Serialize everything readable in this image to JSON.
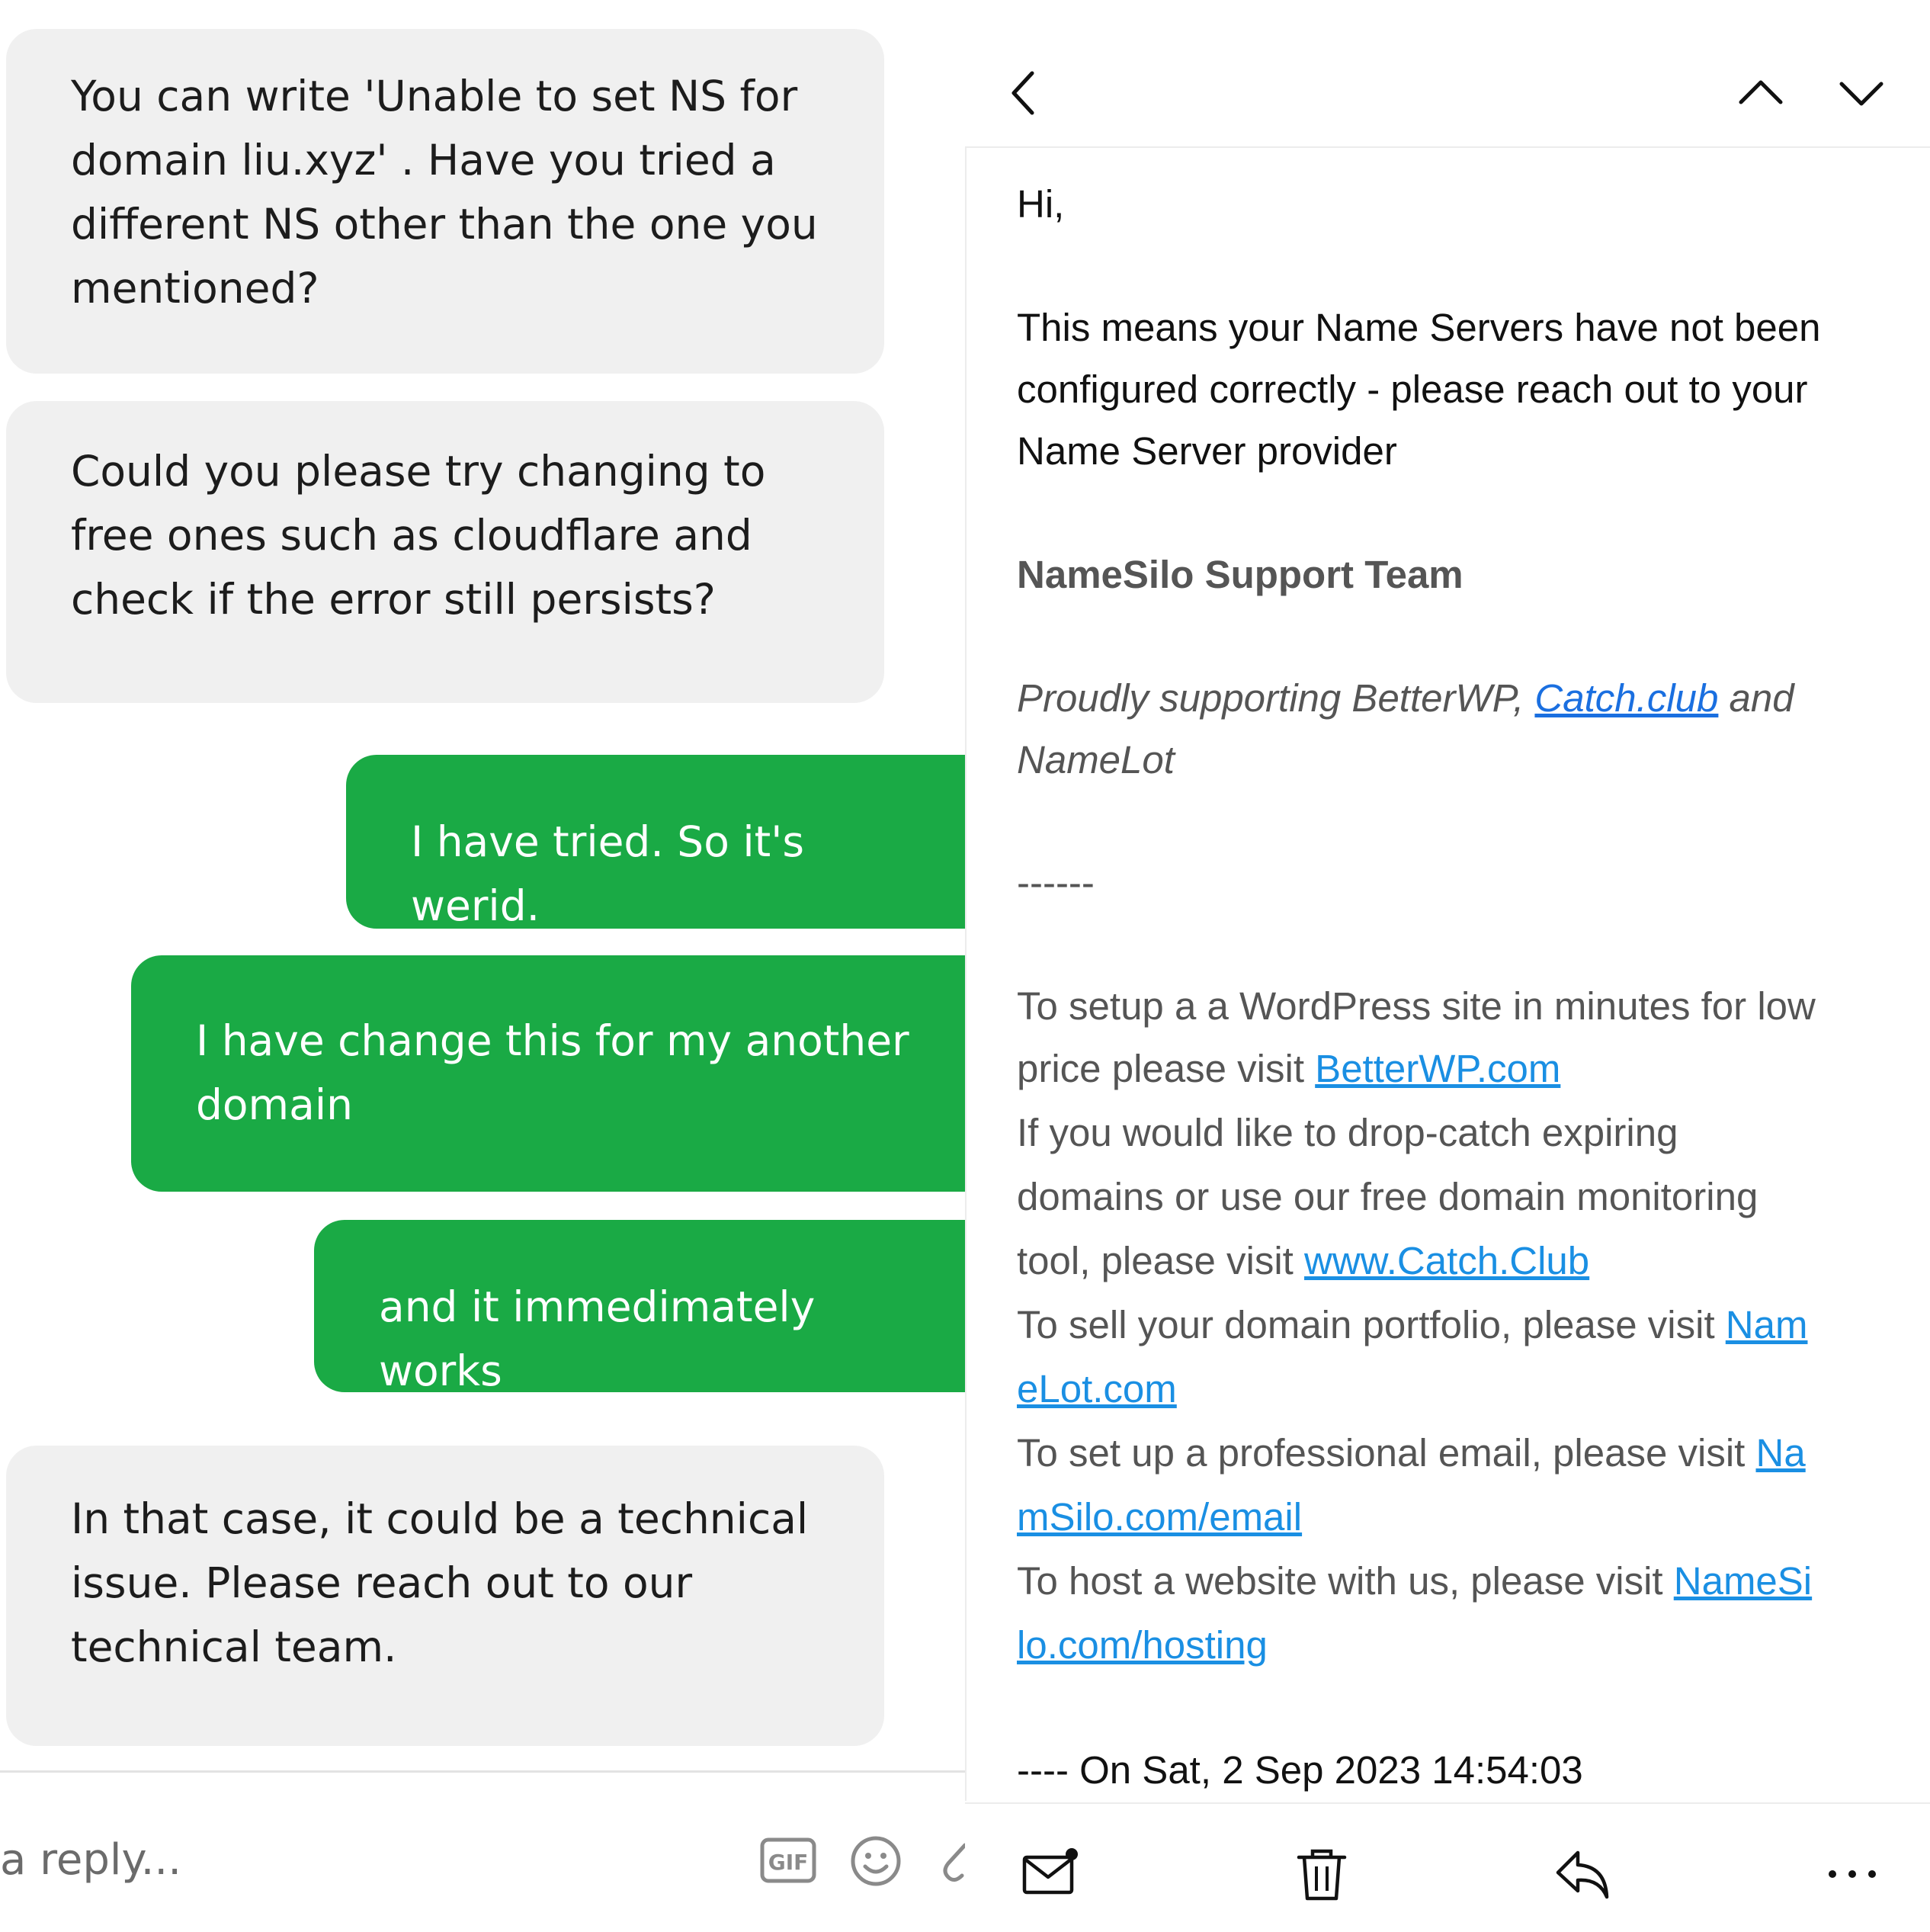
{
  "chat": {
    "messages": [
      {
        "from": "agent",
        "lines": [
          "You can write 'Unable to set NS for",
          "domain liu.xyz' . Have you tried a",
          "different NS other than the one you",
          "mentioned?"
        ]
      },
      {
        "from": "agent",
        "lines": [
          "Could you please try changing to",
          "free ones such as cloudflare and",
          "check if the error still persists?"
        ]
      },
      {
        "from": "user",
        "lines": [
          "I have tried. So it's werid."
        ]
      },
      {
        "from": "user",
        "lines": [
          "I have change this for my another",
          "domain"
        ]
      },
      {
        "from": "user",
        "lines": [
          "and it immedimately works"
        ]
      },
      {
        "from": "agent",
        "lines": [
          "In that case, it could be a technical",
          "issue. Please reach out to our",
          "technical team."
        ]
      }
    ],
    "composer": {
      "placeholder": "a reply...",
      "icons": [
        "gif-icon",
        "emoji-icon",
        "attachment-icon"
      ]
    },
    "colors": {
      "user_bubble": "#1aaa45",
      "agent_bubble": "#f0f0f0"
    }
  },
  "email": {
    "header": {
      "icons": [
        "back-chevron-icon",
        "previous-message-icon",
        "next-message-icon"
      ]
    },
    "body": {
      "greeting": "Hi,",
      "message_lines": [
        "This means your Name Servers have not been",
        "configured correctly - please reach out to your",
        "Name Server provider"
      ],
      "signature": "NameSilo Support Team",
      "proudly_1a": "Proudly supporting BetterWP, ",
      "proudly_link": "Catch.club",
      "proudly_1b": " and",
      "proudly_2": "NameLot",
      "separator": "------",
      "promo": {
        "l1": "To setup a a WordPress site in minutes for low",
        "l2_text": "price please visit ",
        "l2_link": "BetterWP.com",
        "l3": "If you would like to drop-catch expiring",
        "l4": "domains or use our free domain monitoring",
        "l5_text": "tool, please visit ",
        "l5_link": "www.Catch.Club",
        "l6_text": "To sell your domain portfolio, please visit ",
        "l6_link": "Nam",
        "l7_link": "eLot.com",
        "l8_text": "To set up a professional email, please visit ",
        "l8_link": "Na",
        "l9_link": "mSilo.com/email",
        "l10_text": "To host a website with us, please visit ",
        "l10_link": "NameSi",
        "l11_link": "lo.com/hosting"
      },
      "quote_line": "---- On  Sat, 2 Sep 2023 14:54:03"
    },
    "toolbar": {
      "icons": [
        "mark-unread-icon",
        "trash-icon",
        "reply-icon",
        "more-icon"
      ]
    }
  }
}
